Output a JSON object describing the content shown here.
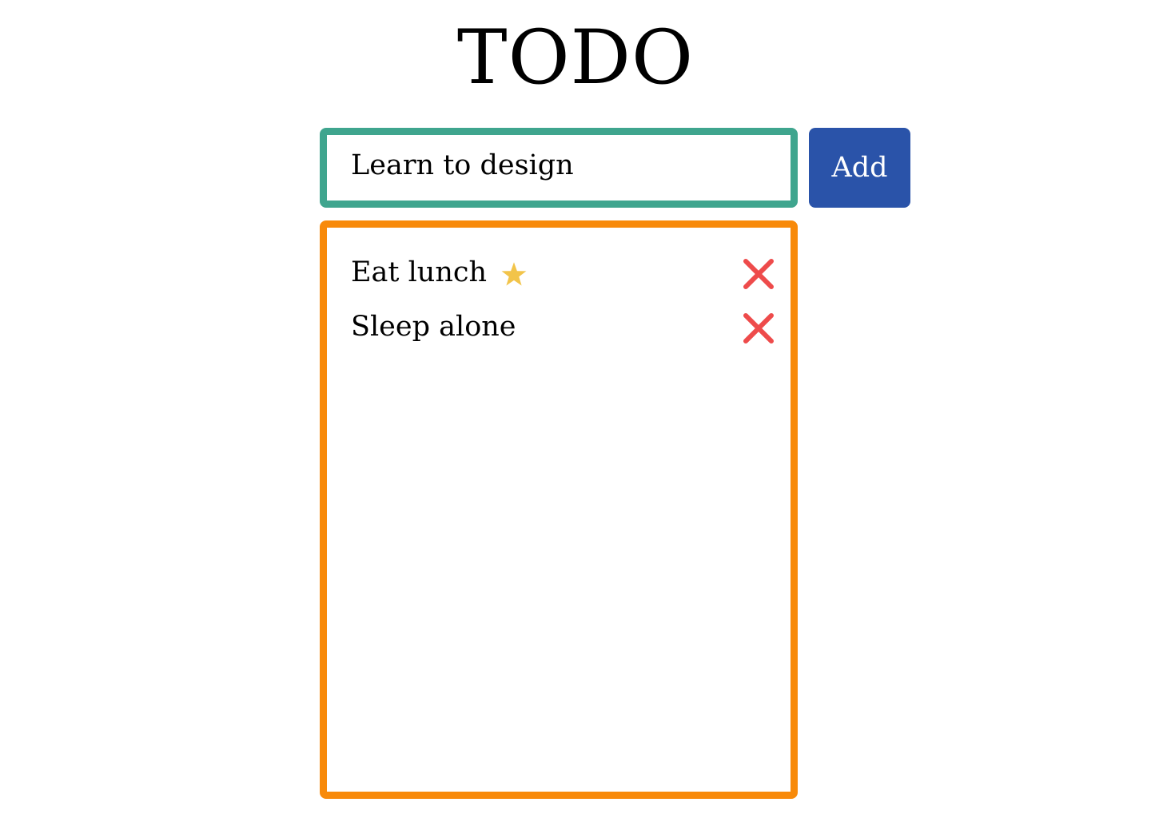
{
  "header": {
    "title": "TODO"
  },
  "new_todo": {
    "value": "Learn to design",
    "add_label": "Add"
  },
  "todos": [
    {
      "label": "Eat lunch",
      "starred": true,
      "delete_icon": "close-icon"
    },
    {
      "label": "Sleep alone",
      "starred": false,
      "delete_icon": "close-icon"
    }
  ],
  "colors": {
    "input_border": "#3FA58E",
    "list_border": "#F88A0A",
    "add_button_bg": "#2A53A9",
    "star": "#F2C44A",
    "delete": "#EE4B4B"
  }
}
